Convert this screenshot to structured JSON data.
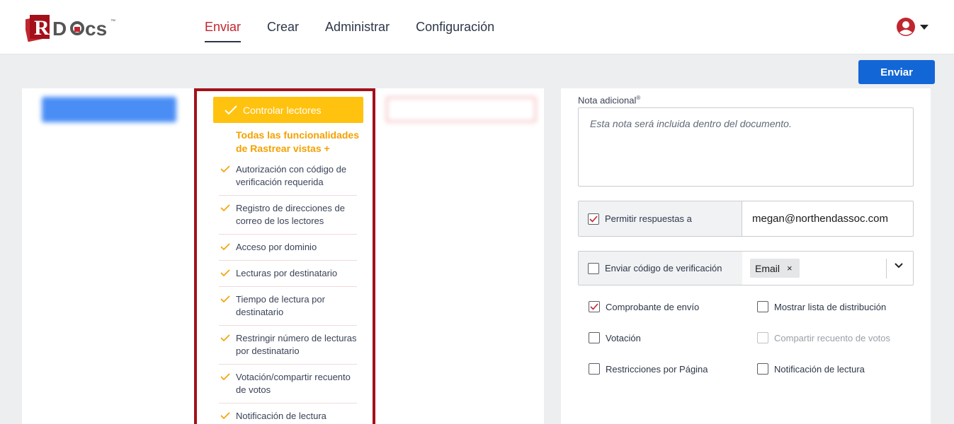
{
  "header": {
    "logo_text": "RDocs",
    "nav": [
      {
        "label": "Enviar",
        "active": true
      },
      {
        "label": "Crear"
      },
      {
        "label": "Administrar"
      },
      {
        "label": "Configuración"
      }
    ],
    "user_icon": "user-circle-icon"
  },
  "toolbar": {
    "send_label": "Enviar"
  },
  "plans": {
    "middle": {
      "title": "Controlar lectores",
      "subtitle": "Todas las funcionalidades de Rastrear vistas +",
      "features": [
        "Autorización con código de verificación requerida",
        "Registro de direcciones de correo de los lectores",
        "Acceso por dominio",
        "Lecturas por destinatario",
        "Tiempo de lectura por destinatario",
        "Restringir número de lecturas por destinatario",
        "Votación/compartir recuento de votos",
        "Notificación de lectura"
      ]
    }
  },
  "form": {
    "note_label": "Nota adicional",
    "note_placeholder": "Esta nota será incluida dentro del documento.",
    "reply_label": "Permitir respuestas a",
    "reply_checked": true,
    "reply_email": "megan@northendassoc.com",
    "verify_label": "Enviar código de verificación",
    "verify_checked": false,
    "verify_chip": "Email",
    "verify_chip_remove": "×",
    "options": [
      {
        "label": "Comprobante de envío",
        "checked": true,
        "disabled": false
      },
      {
        "label": "Mostrar lista de distribución",
        "checked": false,
        "disabled": false
      },
      {
        "label": "Votación",
        "checked": false,
        "disabled": false
      },
      {
        "label": "Compartir recuento de votos",
        "checked": false,
        "disabled": true
      },
      {
        "label": "Restricciones por Página",
        "checked": false,
        "disabled": false
      },
      {
        "label": "Notificación de lectura",
        "checked": false,
        "disabled": false
      }
    ]
  },
  "colors": {
    "accent_red": "#c0262f",
    "primary_blue": "#1366d6",
    "highlight_yellow": "#ffc20e"
  }
}
